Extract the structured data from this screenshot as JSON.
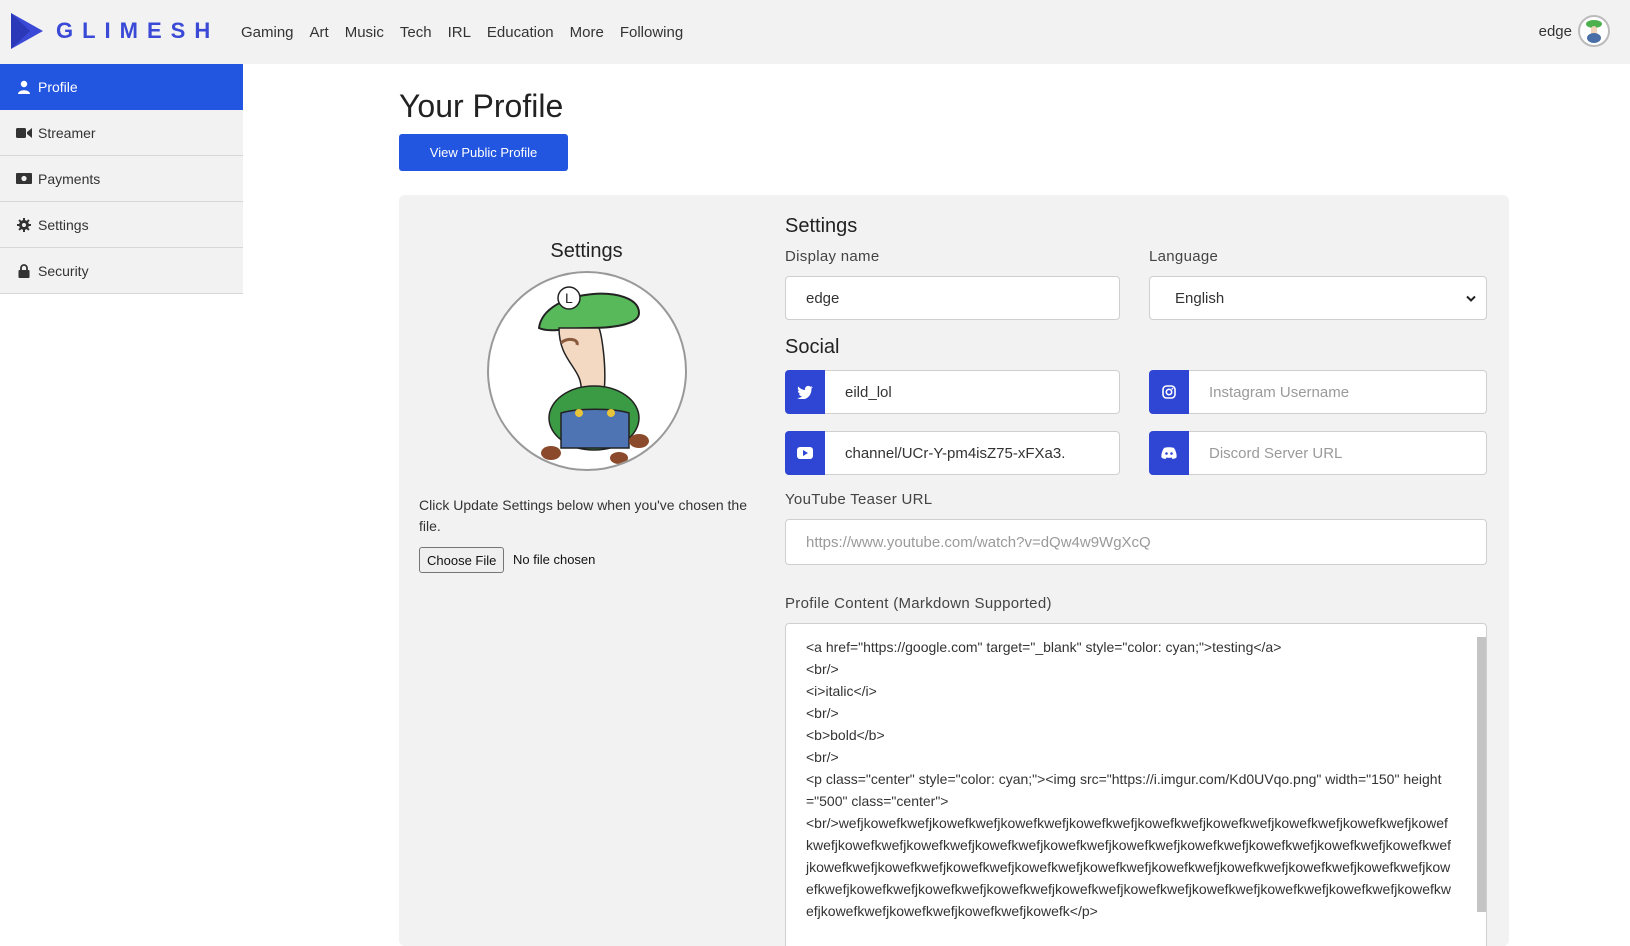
{
  "brand": {
    "name": "GLIMESH",
    "accent": "#2356e0"
  },
  "nav": [
    "Gaming",
    "Art",
    "Music",
    "Tech",
    "IRL",
    "Education",
    "More",
    "Following"
  ],
  "user": {
    "name": "edge"
  },
  "sidebar": {
    "items": [
      {
        "label": "Profile",
        "icon": "user-icon",
        "active": true
      },
      {
        "label": "Streamer",
        "icon": "video-camera-icon"
      },
      {
        "label": "Payments",
        "icon": "money-icon"
      },
      {
        "label": "Settings",
        "icon": "gear-icon"
      },
      {
        "label": "Security",
        "icon": "lock-icon"
      }
    ]
  },
  "main": {
    "title": "Your Profile",
    "view_public_label": "View Public Profile"
  },
  "avatar_panel": {
    "title": "Settings",
    "hint": "Click Update Settings below when you've chosen the file.",
    "choose_file_label": "Choose File",
    "file_status": "No file chosen"
  },
  "form": {
    "settings_heading": "Settings",
    "display_name": {
      "label": "Display name",
      "value": "edge"
    },
    "language": {
      "label": "Language",
      "value": "English"
    },
    "social_heading": "Social",
    "twitter": {
      "value": "eild_lol"
    },
    "instagram": {
      "placeholder": "Instagram Username"
    },
    "youtube": {
      "value": "channel/UCr-Y-pm4isZ75-xFXa3."
    },
    "discord": {
      "placeholder": "Discord Server URL"
    },
    "teaser": {
      "label": "YouTube Teaser URL",
      "placeholder": "https://www.youtube.com/watch?v=dQw4w9WgXcQ"
    },
    "profile_content": {
      "label": "Profile Content (Markdown Supported)",
      "value": "<a href=\"https://google.com\" target=\"_blank\" style=\"color: cyan;\">testing</a>\n<br/>\n<i>italic</i>\n<br/>\n<b>bold</b>\n<br/>\n<p class=\"center\" style=\"color: cyan;\"><img src=\"https://i.imgur.com/Kd0UVqo.png\" width=\"150\" height=\"500\" class=\"center\">\n<br/>wefjkowefkwefjkowefkwefjkowefkwefjkowefkwefjkowefkwefjkowefkwefjkowefkwefjkowefkwefjkowefkwefjkowefkwefjkowefkwefjkowefkwefjkowefkwefjkowefkwefjkowefkwefjkowefkwefjkowefkwefjkowefkwefjkowefkwefjkowefkwefjkowefkwefjkowefkwefjkowefkwefjkowefkwefjkowefkwefjkowefkwefjkowefkwefjkowefkwefjkowefkwefjkowefkwefjkowefkwefjkowefkwefjkowefkwefjkowefkwefjkowefkwefjkowefkwefjkowefkwefjkowefkwefjkowefkwefjkowefkwefjkowefk</p>"
    }
  }
}
